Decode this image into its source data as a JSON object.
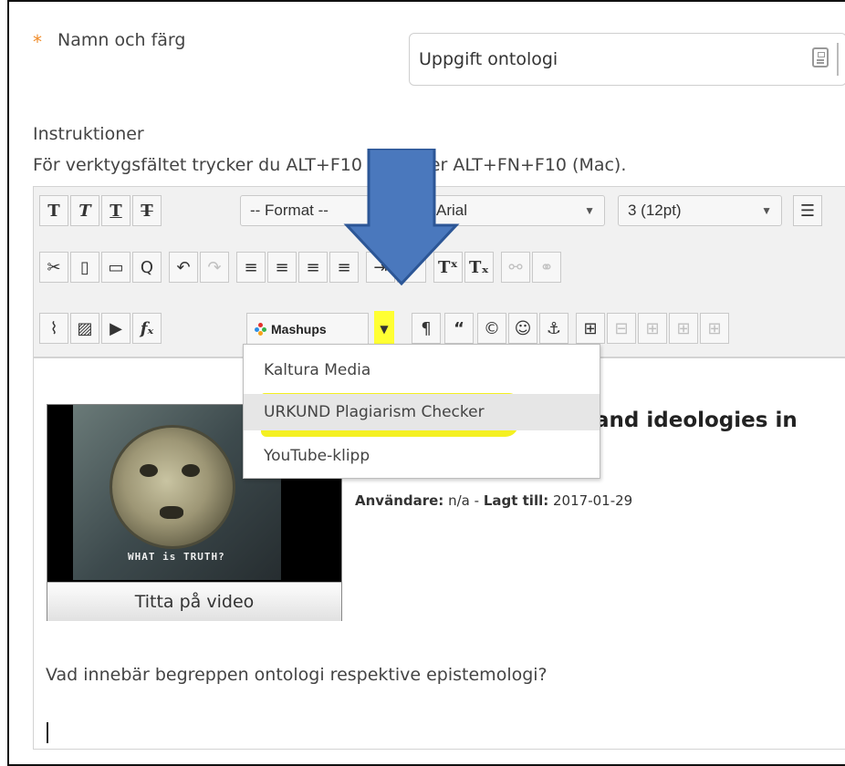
{
  "form": {
    "required_marker": "*",
    "name_label": "Namn och färg",
    "name_value": "Uppgift ontologi",
    "instructions_heading": "Instruktioner",
    "toolbar_hint": "För verktygsfältet trycker du ALT+F10 (PC) eller ALT+FN+F10 (Mac)."
  },
  "toolbar": {
    "format_select": "-- Format --",
    "font_select": "Arial",
    "size_select": "3 (12pt)",
    "mashups_label": "Mashups",
    "highlight_color": "#ffff33",
    "annotation_arrow_color": "#4a78bd"
  },
  "mashups_menu": {
    "items": [
      "Kaltura Media",
      "URKUND Plagiarism Checker",
      "YouTube-klipp"
    ]
  },
  "editor": {
    "video_caption": "WHAT is TRUTH?",
    "video_button": "Titta på video",
    "video_title_visible": "and ideologies in",
    "user_label": "Användare:",
    "user_value": "n/a",
    "separator": "-",
    "added_label": "Lagt till:",
    "added_value": "2017-01-29",
    "question": "Vad innebär begreppen ontologi respektive epistemologi?"
  }
}
